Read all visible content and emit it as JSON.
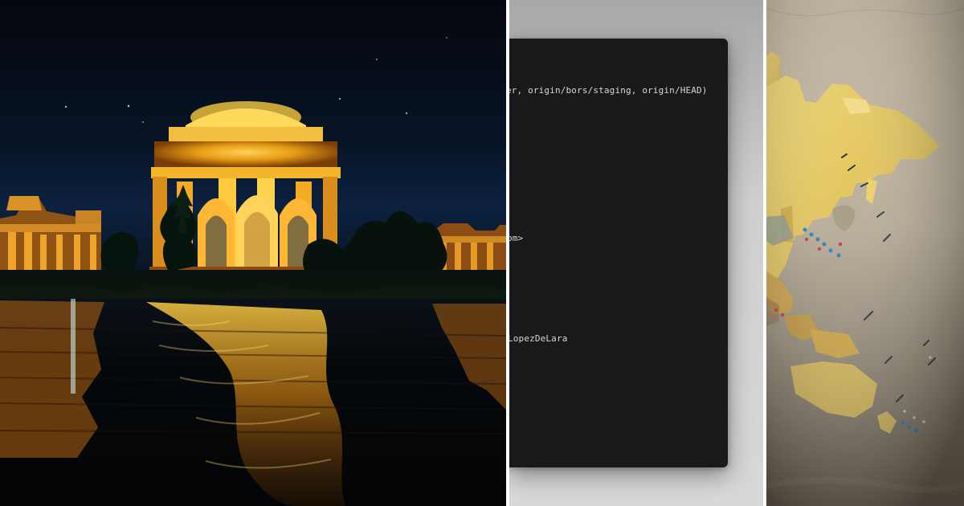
{
  "terminal": {
    "lines": [
      "er, origin/bors/staging, origin/HEAD)",
      "om>",
      "LopezDeLara"
    ]
  },
  "images": {
    "left": "palace-night-photo-icon",
    "middle": "terminal-screenshot-icon",
    "right": "world-map-photo-icon"
  },
  "colors": {
    "night_sky": "#081426",
    "water": "#05080b",
    "gold_light": "#f3b11f",
    "terminal_bg": "#18191b",
    "terminal_text": "#d8d8d8",
    "map_land": "#e2c45a",
    "map_ocean": "#cbbfa6"
  }
}
